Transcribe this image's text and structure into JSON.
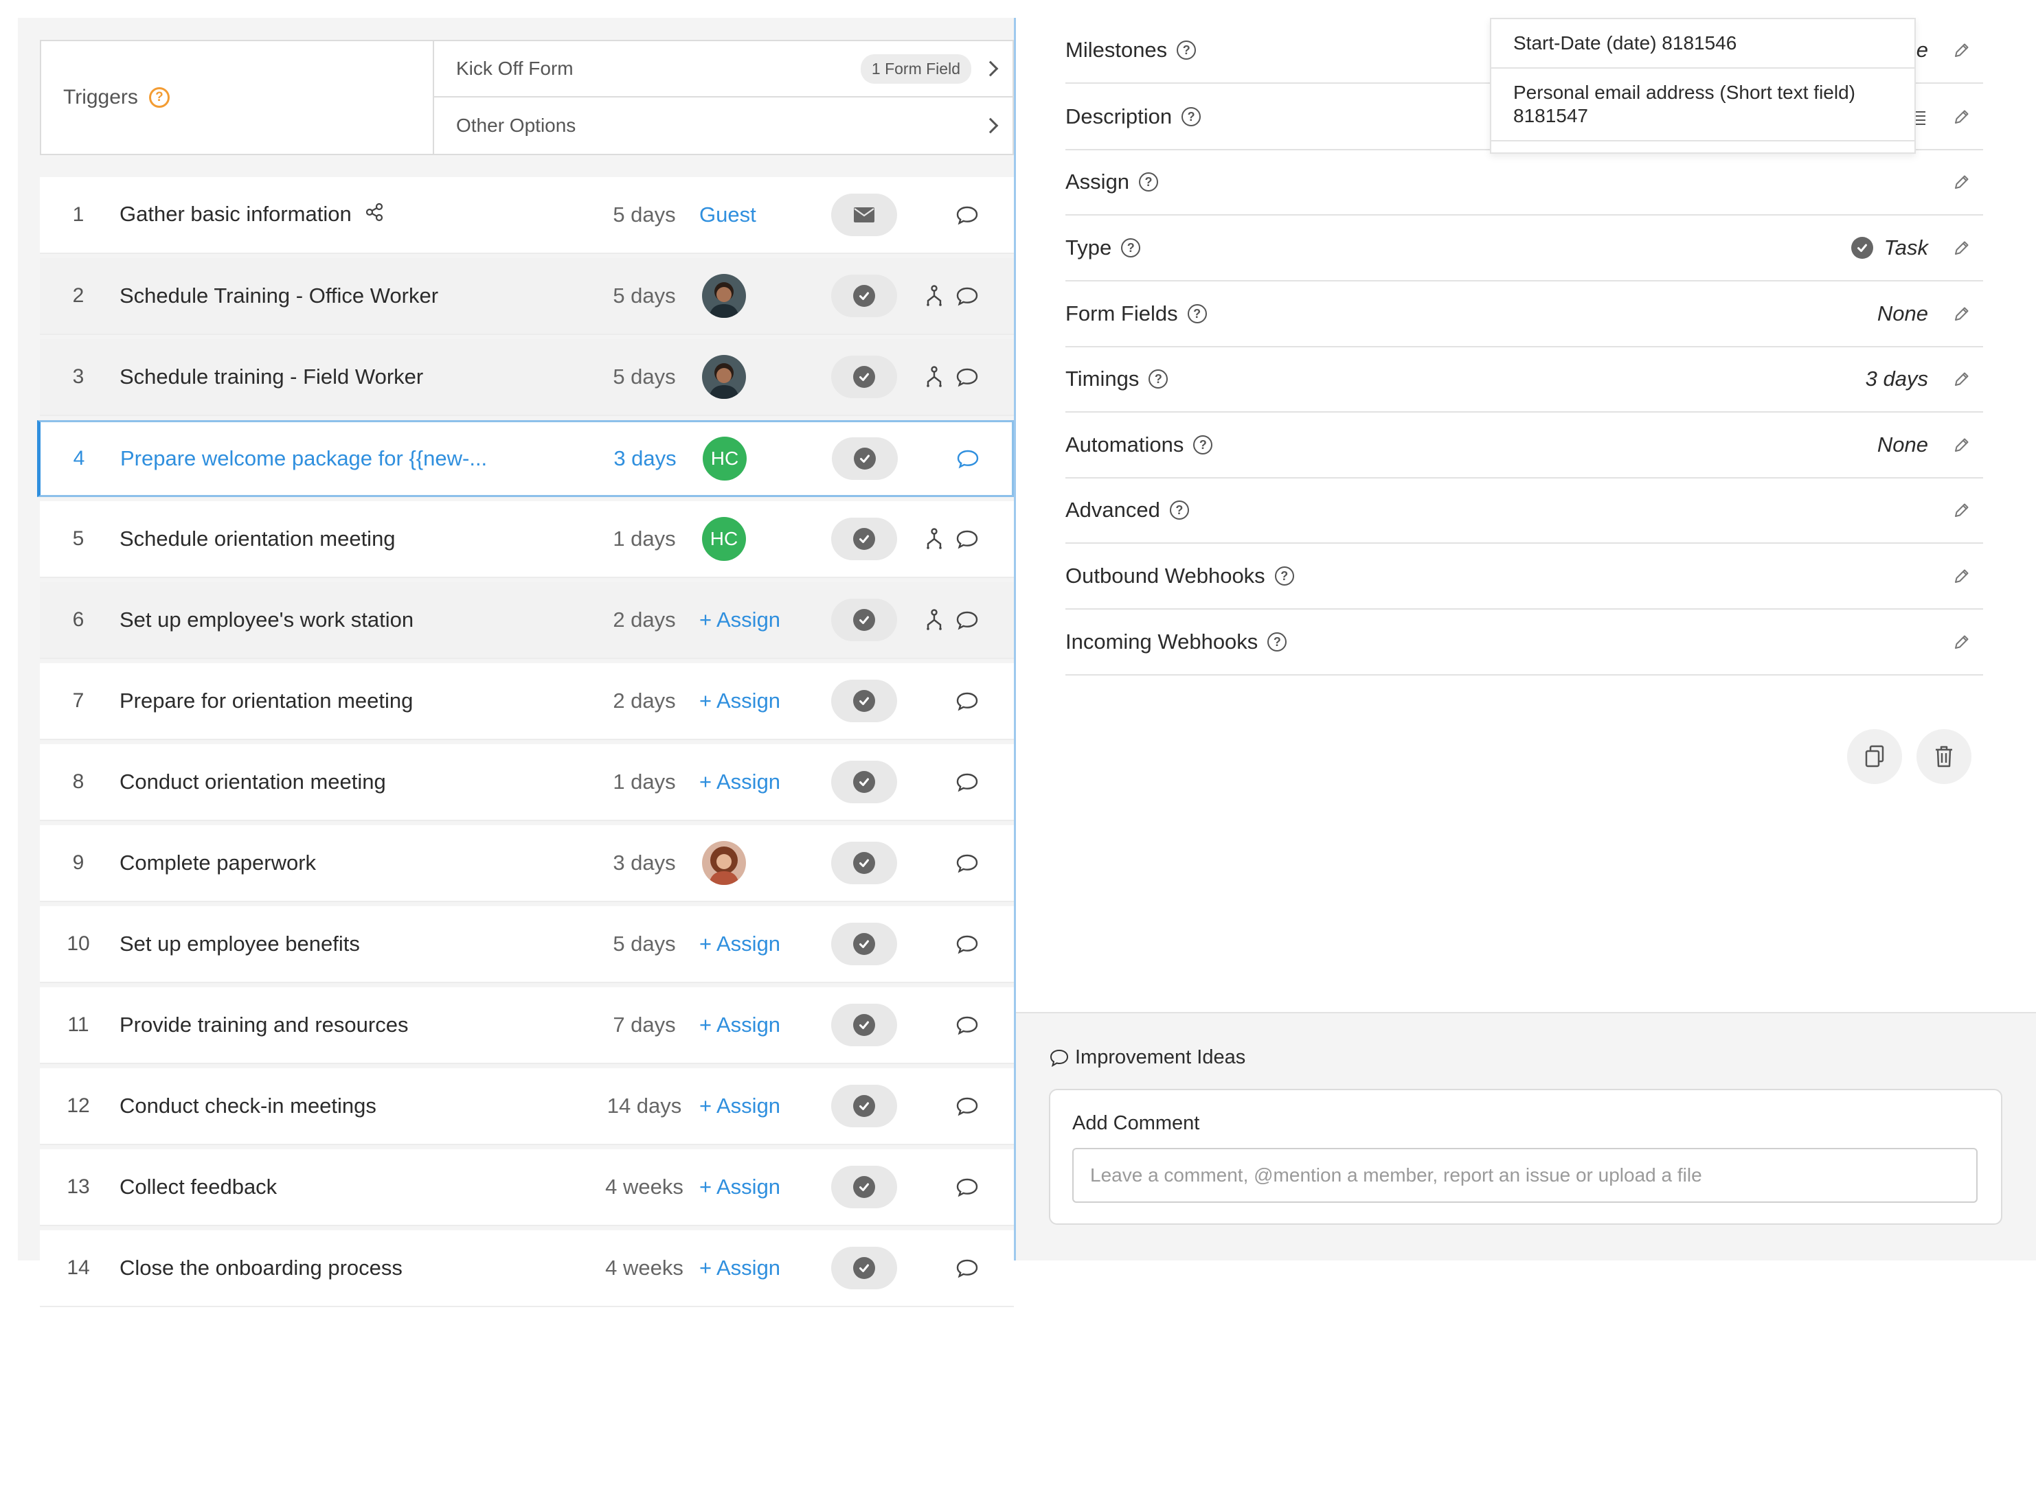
{
  "triggers": {
    "label": "Triggers",
    "rows": [
      {
        "label": "Kick Off Form",
        "badge": "1 Form Field"
      },
      {
        "label": "Other Options"
      }
    ]
  },
  "tasks": [
    {
      "num": "1",
      "name": "Gather basic information",
      "duration": "5 days",
      "assignee_type": "text",
      "assignee": "Guest",
      "status_icon": "envelope-icon"
    },
    {
      "num": "2",
      "name": "Schedule Training - Office Worker",
      "duration": "5 days",
      "assignee_type": "avatar",
      "status_icon": "check-icon"
    },
    {
      "num": "3",
      "name": "Schedule training - Field Worker",
      "duration": "5 days",
      "assignee_type": "avatar",
      "status_icon": "check-icon"
    },
    {
      "num": "4",
      "name": "Prepare welcome package for {{new-...",
      "duration": "3 days",
      "assignee_type": "initials",
      "assignee": "HC",
      "status_icon": "check-icon"
    },
    {
      "num": "5",
      "name": "Schedule orientation meeting",
      "duration": "1 days",
      "assignee_type": "initials",
      "assignee": "HC",
      "status_icon": "check-icon"
    },
    {
      "num": "6",
      "name": "Set up employee's work station",
      "duration": "2 days",
      "assignee_type": "assign",
      "assignee": "+ Assign",
      "status_icon": "check-icon"
    },
    {
      "num": "7",
      "name": "Prepare for orientation meeting",
      "duration": "2 days",
      "assignee_type": "assign",
      "assignee": "+ Assign",
      "status_icon": "check-icon"
    },
    {
      "num": "8",
      "name": "Conduct orientation meeting",
      "duration": "1 days",
      "assignee_type": "assign",
      "assignee": "+ Assign",
      "status_icon": "check-icon"
    },
    {
      "num": "9",
      "name": "Complete paperwork",
      "duration": "3 days",
      "assignee_type": "avatar",
      "status_icon": "check-icon"
    },
    {
      "num": "10",
      "name": "Set up employee benefits",
      "duration": "5 days",
      "assignee_type": "assign",
      "assignee": "+ Assign",
      "status_icon": "check-icon"
    },
    {
      "num": "11",
      "name": "Provide training and resources",
      "duration": "7 days",
      "assignee_type": "assign",
      "assignee": "+ Assign",
      "status_icon": "check-icon"
    },
    {
      "num": "12",
      "name": "Conduct check-in meetings",
      "duration": "14 days",
      "assignee_type": "assign",
      "assignee": "+ Assign",
      "status_icon": "check-icon"
    },
    {
      "num": "13",
      "name": "Collect feedback",
      "duration": "4 weeks",
      "assignee_type": "assign",
      "assignee": "+ Assign",
      "status_icon": "check-icon"
    },
    {
      "num": "14",
      "name": "Close the onboarding process",
      "duration": "4 weeks",
      "assignee_type": "assign",
      "assignee": "+ Assign",
      "status_icon": "check-icon"
    }
  ],
  "properties": [
    {
      "label": "Milestones",
      "value": "ne"
    },
    {
      "label": "Description",
      "value": ""
    },
    {
      "label": "Assign",
      "value": ""
    },
    {
      "label": "Type",
      "value": "Task"
    },
    {
      "label": "Form Fields",
      "value": "None"
    },
    {
      "label": "Timings",
      "value": "3 days"
    },
    {
      "label": "Automations",
      "value": "None"
    },
    {
      "label": "Advanced",
      "value": ""
    },
    {
      "label": "Outbound Webhooks",
      "value": ""
    },
    {
      "label": "Incoming Webhooks",
      "value": ""
    }
  ],
  "dropdown": {
    "items": [
      "Start-Date (date) 8181546",
      "Personal email address (Short text field) 8181547"
    ]
  },
  "improvement": {
    "title": "Improvement Ideas",
    "add_comment": "Add Comment",
    "placeholder": "Leave a comment, @mention a member, report an issue or upload a file"
  },
  "colors": {
    "accent": "#2f8fde",
    "orange": "#f39c33",
    "green_avatar": "#34b35a"
  }
}
